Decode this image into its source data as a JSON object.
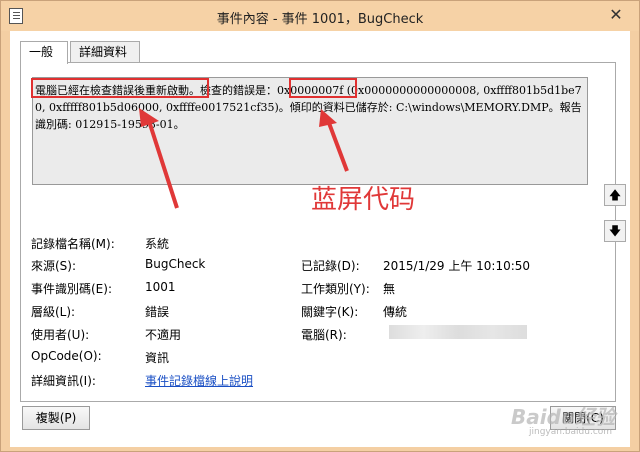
{
  "window": {
    "title": "事件內容 - 事件 1001，BugCheck",
    "close_label": "✕"
  },
  "tabs": [
    {
      "label": "一般"
    },
    {
      "label": "詳細資料"
    }
  ],
  "description": {
    "part1": "電腦已經在檢查錯誤後重新啟動",
    "part2": "。檢查的錯誤是：",
    "code": "0x0000007f",
    "part3": " (0x0000000000000008, 0xffff801b5d1be70, 0xfffff801b5d06000, 0xffffe0017521cf35)。傾印的資料已儲存於: C:\\windows\\MEMORY.DMP。報告識別碼: 012915-19593-01。"
  },
  "annotation": {
    "text": "蓝屏代码",
    "color": "#e03838"
  },
  "fields_left": [
    {
      "label": "記錄檔名稱(M):",
      "value": "系統"
    },
    {
      "label": "來源(S):",
      "value": "BugCheck"
    },
    {
      "label": "事件識別碼(E):",
      "value": "1001"
    },
    {
      "label": "層級(L):",
      "value": "錯誤"
    },
    {
      "label": "使用者(U):",
      "value": "不適用"
    },
    {
      "label": "OpCode(O):",
      "value": "資訊"
    },
    {
      "label": "詳細資訊(I):",
      "value": "事件記錄檔線上說明"
    }
  ],
  "fields_right": [
    {
      "label": "已記錄(D):",
      "value": "2015/1/29 上午 10:10:50"
    },
    {
      "label": "工作類別(Y):",
      "value": "無"
    },
    {
      "label": "關鍵字(K):",
      "value": "傳統"
    },
    {
      "label": "電腦(R):",
      "value": ""
    }
  ],
  "buttons": {
    "copy": "複製(P)",
    "close": "關閉(C)"
  },
  "scroll": {
    "up": "🡅",
    "down": "🡇"
  },
  "watermark": {
    "brand": "Baidu经验",
    "sub": "jingyan.baidu.com"
  }
}
